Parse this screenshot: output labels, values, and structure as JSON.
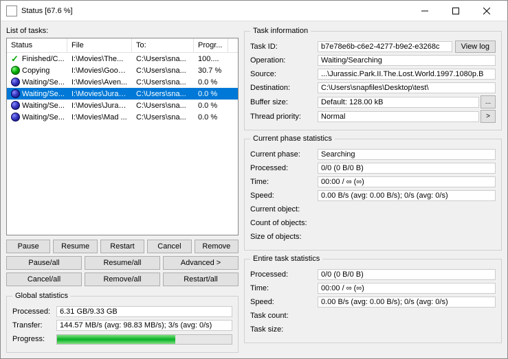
{
  "window": {
    "title": "Status [67.6 %]"
  },
  "listLabel": "List of tasks:",
  "columns": {
    "status": "Status",
    "file": "File",
    "to": "To:",
    "prog": "Progr..."
  },
  "tasks": [
    {
      "status": "Finished/C...",
      "file": "I:\\Movies\\The...",
      "to": "C:\\Users\\sna...",
      "prog": "100....",
      "icon": "finished"
    },
    {
      "status": "Copying",
      "file": "I:\\Movies\\Goos...",
      "to": "C:\\Users\\sna...",
      "prog": "30.7 %",
      "icon": "copying"
    },
    {
      "status": "Waiting/Se...",
      "file": "I:\\Movies\\Aven...",
      "to": "C:\\Users\\sna...",
      "prog": "0.0 %",
      "icon": "waiting"
    },
    {
      "status": "Waiting/Se...",
      "file": "I:\\Movies\\Juras...",
      "to": "C:\\Users\\sna...",
      "prog": "0.0 %",
      "icon": "waiting",
      "selected": true
    },
    {
      "status": "Waiting/Se...",
      "file": "I:\\Movies\\Juras...",
      "to": "C:\\Users\\sna...",
      "prog": "0.0 %",
      "icon": "waiting"
    },
    {
      "status": "Waiting/Se...",
      "file": "I:\\Movies\\Mad ...",
      "to": "C:\\Users\\sna...",
      "prog": "0.0 %",
      "icon": "waiting"
    }
  ],
  "buttons": {
    "pause": "Pause",
    "resume": "Resume",
    "restart": "Restart",
    "cancel": "Cancel",
    "remove": "Remove",
    "pauseAll": "Pause/all",
    "resumeAll": "Resume/all",
    "advanced": "Advanced >",
    "cancelAll": "Cancel/all",
    "removeAll": "Remove/all",
    "restartAll": "Restart/all"
  },
  "global": {
    "title": "Global statistics",
    "processedLabel": "Processed:",
    "processed": "6.31 GB/9.33 GB",
    "transferLabel": "Transfer:",
    "transfer": "144.57 MB/s (avg: 98.83 MB/s); 3/s (avg: 0/s)",
    "progressLabel": "Progress:",
    "progressPct": 67.6
  },
  "taskInfo": {
    "title": "Task information",
    "taskIdLabel": "Task ID:",
    "taskId": "b7e78e6b-c6e2-4277-b9e2-e3268c",
    "viewLog": "View log",
    "operationLabel": "Operation:",
    "operation": "Waiting/Searching",
    "sourceLabel": "Source:",
    "source": "...\\Jurassic.Park.II.The.Lost.World.1997.1080p.B",
    "destLabel": "Destination:",
    "dest": "C:\\Users\\snapfiles\\Desktop\\test\\",
    "bufferLabel": "Buffer size:",
    "buffer": "Default: 128.00 kB",
    "priorityLabel": "Thread priority:",
    "priority": "Normal"
  },
  "currentPhase": {
    "title": "Current phase statistics",
    "phaseLabel": "Current phase:",
    "phase": "Searching",
    "processedLabel": "Processed:",
    "processed": "0/0 (0 B/0 B)",
    "timeLabel": "Time:",
    "time": "00:00 / ∞ (∞)",
    "speedLabel": "Speed:",
    "speed": "0.00 B/s (avg: 0.00 B/s); 0/s (avg: 0/s)",
    "currObjLabel": "Current object:",
    "countObjLabel": "Count of objects:",
    "sizeObjLabel": "Size of objects:"
  },
  "entire": {
    "title": "Entire task statistics",
    "processedLabel": "Processed:",
    "processed": "0/0 (0 B/0 B)",
    "timeLabel": "Time:",
    "time": "00:00 / ∞ (∞)",
    "speedLabel": "Speed:",
    "speed": "0.00 B/s (avg: 0.00 B/s); 0/s (avg: 0/s)",
    "taskCountLabel": "Task count:",
    "taskSizeLabel": "Task size:"
  }
}
